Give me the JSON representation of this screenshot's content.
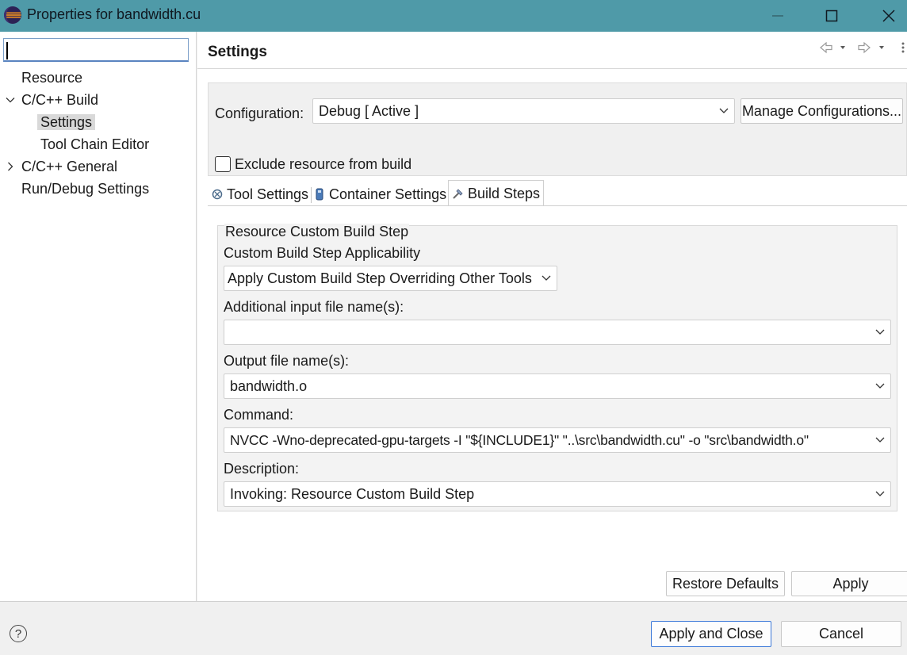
{
  "window": {
    "title": "Properties for bandwidth.cu"
  },
  "sidebar": {
    "filter_value": "",
    "items": [
      {
        "label": "Resource"
      },
      {
        "label": "C/C++ Build",
        "expanded": true
      },
      {
        "label": "Settings",
        "selected": true
      },
      {
        "label": "Tool Chain Editor"
      },
      {
        "label": "C/C++ General",
        "expanded": false
      },
      {
        "label": "Run/Debug Settings"
      }
    ]
  },
  "page": {
    "title": "Settings"
  },
  "configuration": {
    "label": "Configuration:",
    "value": "Debug  [ Active ]",
    "manage_button": "Manage Configurations...",
    "exclude_label": "Exclude resource from build",
    "exclude_checked": false
  },
  "tabs": [
    {
      "label": "Tool Settings"
    },
    {
      "label": "Container Settings"
    },
    {
      "label": "Build Steps",
      "active": true
    }
  ],
  "build_step": {
    "group_title": "Resource Custom Build Step",
    "applicability_label": "Custom Build Step Applicability",
    "applicability_value": "Apply Custom Build Step Overriding Other Tools",
    "input_label": "Additional input file name(s):",
    "input_value": "",
    "output_label": "Output file name(s):",
    "output_value": "bandwidth.o",
    "command_label": "Command:",
    "command_value": "NVCC -Wno-deprecated-gpu-targets -I \"${INCLUDE1}\" \"..\\src\\bandwidth.cu\" -o \"src\\bandwidth.o\"",
    "description_label": "Description:",
    "description_value": "Invoking: Resource Custom Build Step"
  },
  "buttons": {
    "restore_defaults": "Restore Defaults",
    "apply": "Apply",
    "apply_and_close": "Apply and Close",
    "cancel": "Cancel",
    "help": "?"
  },
  "colors": {
    "titlebar": "#4f9aa8",
    "default_button_border": "#3b78d8"
  }
}
